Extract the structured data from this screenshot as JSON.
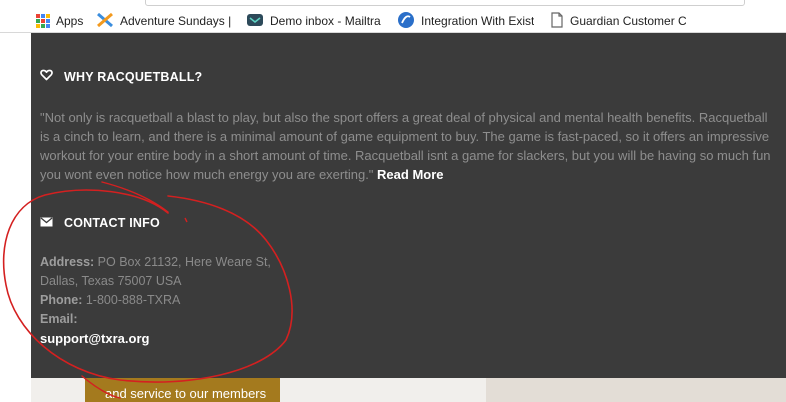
{
  "bookmarks": {
    "items": [
      {
        "label": "Apps",
        "icon": "apps-grid-icon"
      },
      {
        "label": "Adventure Sundays |",
        "icon": "adventure-logo-icon"
      },
      {
        "label": "Demo inbox - Mailtra",
        "icon": "mailtrap-icon"
      },
      {
        "label": "Integration With Exist",
        "icon": "integration-logo-icon"
      },
      {
        "label": "Guardian Customer C",
        "icon": "page-icon"
      }
    ]
  },
  "why": {
    "heading": "WHY RACQUETBALL?",
    "icon": "heart-icon",
    "text": "\"Not only is racquetball a blast to play, but also the sport offers a great deal of physical and mental health benefits. Racquetball is a cinch to learn, and there is a minimal amount of game equipment to buy. The game is fast-paced, so it offers an impressive workout for your entire body in a short amount of time. Racquetball isnt a game for slackers, but you will be having so much fun you wont even notice how much energy you are exerting.\"",
    "read_more": "Read More"
  },
  "contact": {
    "heading": "CONTACT INFO",
    "icon": "envelope-icon",
    "address_label": "Address:",
    "address_line1": "PO Box 21132, Here Weare St,",
    "address_line2": "Dallas, Texas 75007 USA",
    "phone_label": "Phone:",
    "phone": "1-800-888-TXRA",
    "email_label": "Email:",
    "email": "support@txra.org"
  },
  "below": {
    "gold_text": "and service to our members"
  },
  "colors": {
    "dark_bg": "#3b3b3b",
    "muted_text": "#8e8e8e",
    "gold": "#a47a1e",
    "annotation_red": "#d42020"
  }
}
